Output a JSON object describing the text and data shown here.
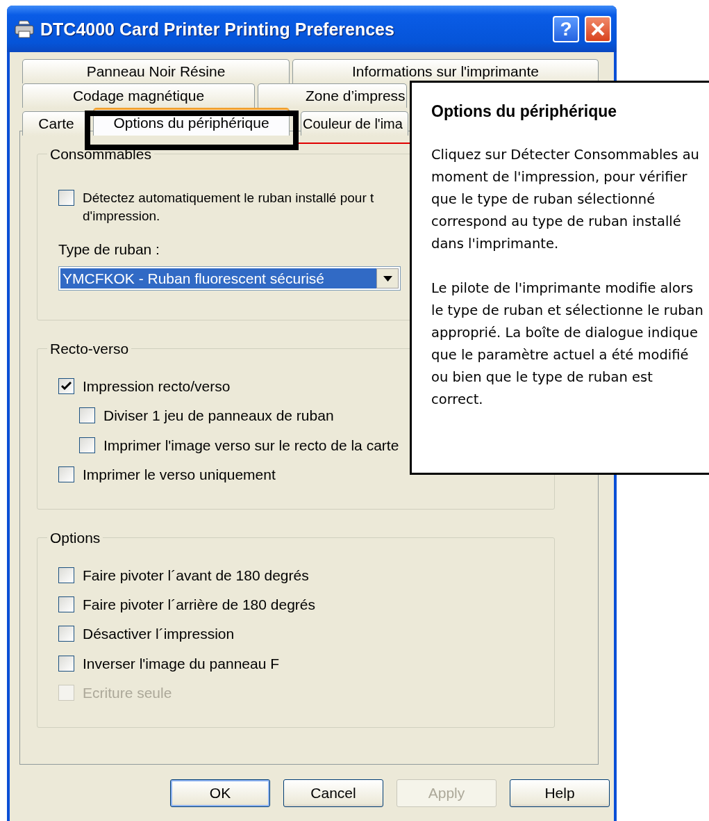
{
  "window": {
    "title": "DTC4000 Card Printer Printing Preferences",
    "help_button": "?"
  },
  "tab_rows": [
    [
      {
        "label": "Panneau Noir Résine",
        "selected": false
      },
      {
        "label": "Informations sur l'imprimante",
        "selected": false
      }
    ],
    [
      {
        "label": "Codage magnétique",
        "selected": false
      },
      {
        "label": "Zone d’impress",
        "selected": false
      }
    ],
    [
      {
        "label": "Carte",
        "selected": false
      },
      {
        "label": "Options du périphérique",
        "selected": true
      },
      {
        "label": "Couleur de l'ima",
        "selected": false
      }
    ]
  ],
  "groups": [
    {
      "title": "Consommables",
      "items": [
        {
          "kind": "checkbox",
          "label": "Détectez automatiquement le ruban installé pour t d'impression.",
          "checked": false,
          "disabled": false
        },
        {
          "kind": "label",
          "label": "Type de ruban :"
        },
        {
          "kind": "dropdown",
          "value": "YMCFKOK - Ruban fluorescent sécurisé",
          "highlighted": true
        }
      ]
    },
    {
      "title": "Recto-verso",
      "items": [
        {
          "kind": "checkbox",
          "label": "Impression recto/verso",
          "checked": true,
          "disabled": false,
          "children": [
            {
              "kind": "checkbox",
              "label": "Diviser 1 jeu de panneaux de ruban",
              "checked": false,
              "disabled": false
            },
            {
              "kind": "checkbox",
              "label": "Imprimer l'image verso sur le recto de la carte",
              "checked": false,
              "disabled": false
            }
          ]
        },
        {
          "kind": "checkbox",
          "label": "Imprimer le verso uniquement",
          "checked": false,
          "disabled": false
        }
      ]
    },
    {
      "title": "Options",
      "items": [
        {
          "kind": "checkbox",
          "label": "Faire pivoter l´avant de 180 degrés",
          "checked": false,
          "disabled": false
        },
        {
          "kind": "checkbox",
          "label": "Faire pivoter l´arrière de 180 degrés",
          "checked": false,
          "disabled": false
        },
        {
          "kind": "checkbox",
          "label": "Désactiver l´impression",
          "checked": false,
          "disabled": false
        },
        {
          "kind": "checkbox",
          "label": "Inverser l'image du panneau F",
          "checked": false,
          "disabled": false
        },
        {
          "kind": "checkbox",
          "label": "Ecriture seule",
          "checked": false,
          "disabled": true
        }
      ]
    }
  ],
  "buttons": [
    {
      "label": "OK",
      "default": true,
      "disabled": false
    },
    {
      "label": "Cancel",
      "default": false,
      "disabled": false
    },
    {
      "label": "Apply",
      "default": false,
      "disabled": true
    },
    {
      "label": "Help",
      "default": false,
      "disabled": false
    }
  ],
  "callout": {
    "title": "Options du périphérique",
    "paragraphs": [
      "Cliquez sur Détecter Consommables au moment de l'impression, pour vérifier que le type de ruban sélectionné correspond au type de ruban installé dans l'imprimante.",
      "Le pilote de l'imprimante modifie alors le type de ruban et sélectionne le ruban approprié. La boîte de dialogue indique que le paramètre actuel a été modifié ou bien que le type de ruban est correct."
    ]
  }
}
